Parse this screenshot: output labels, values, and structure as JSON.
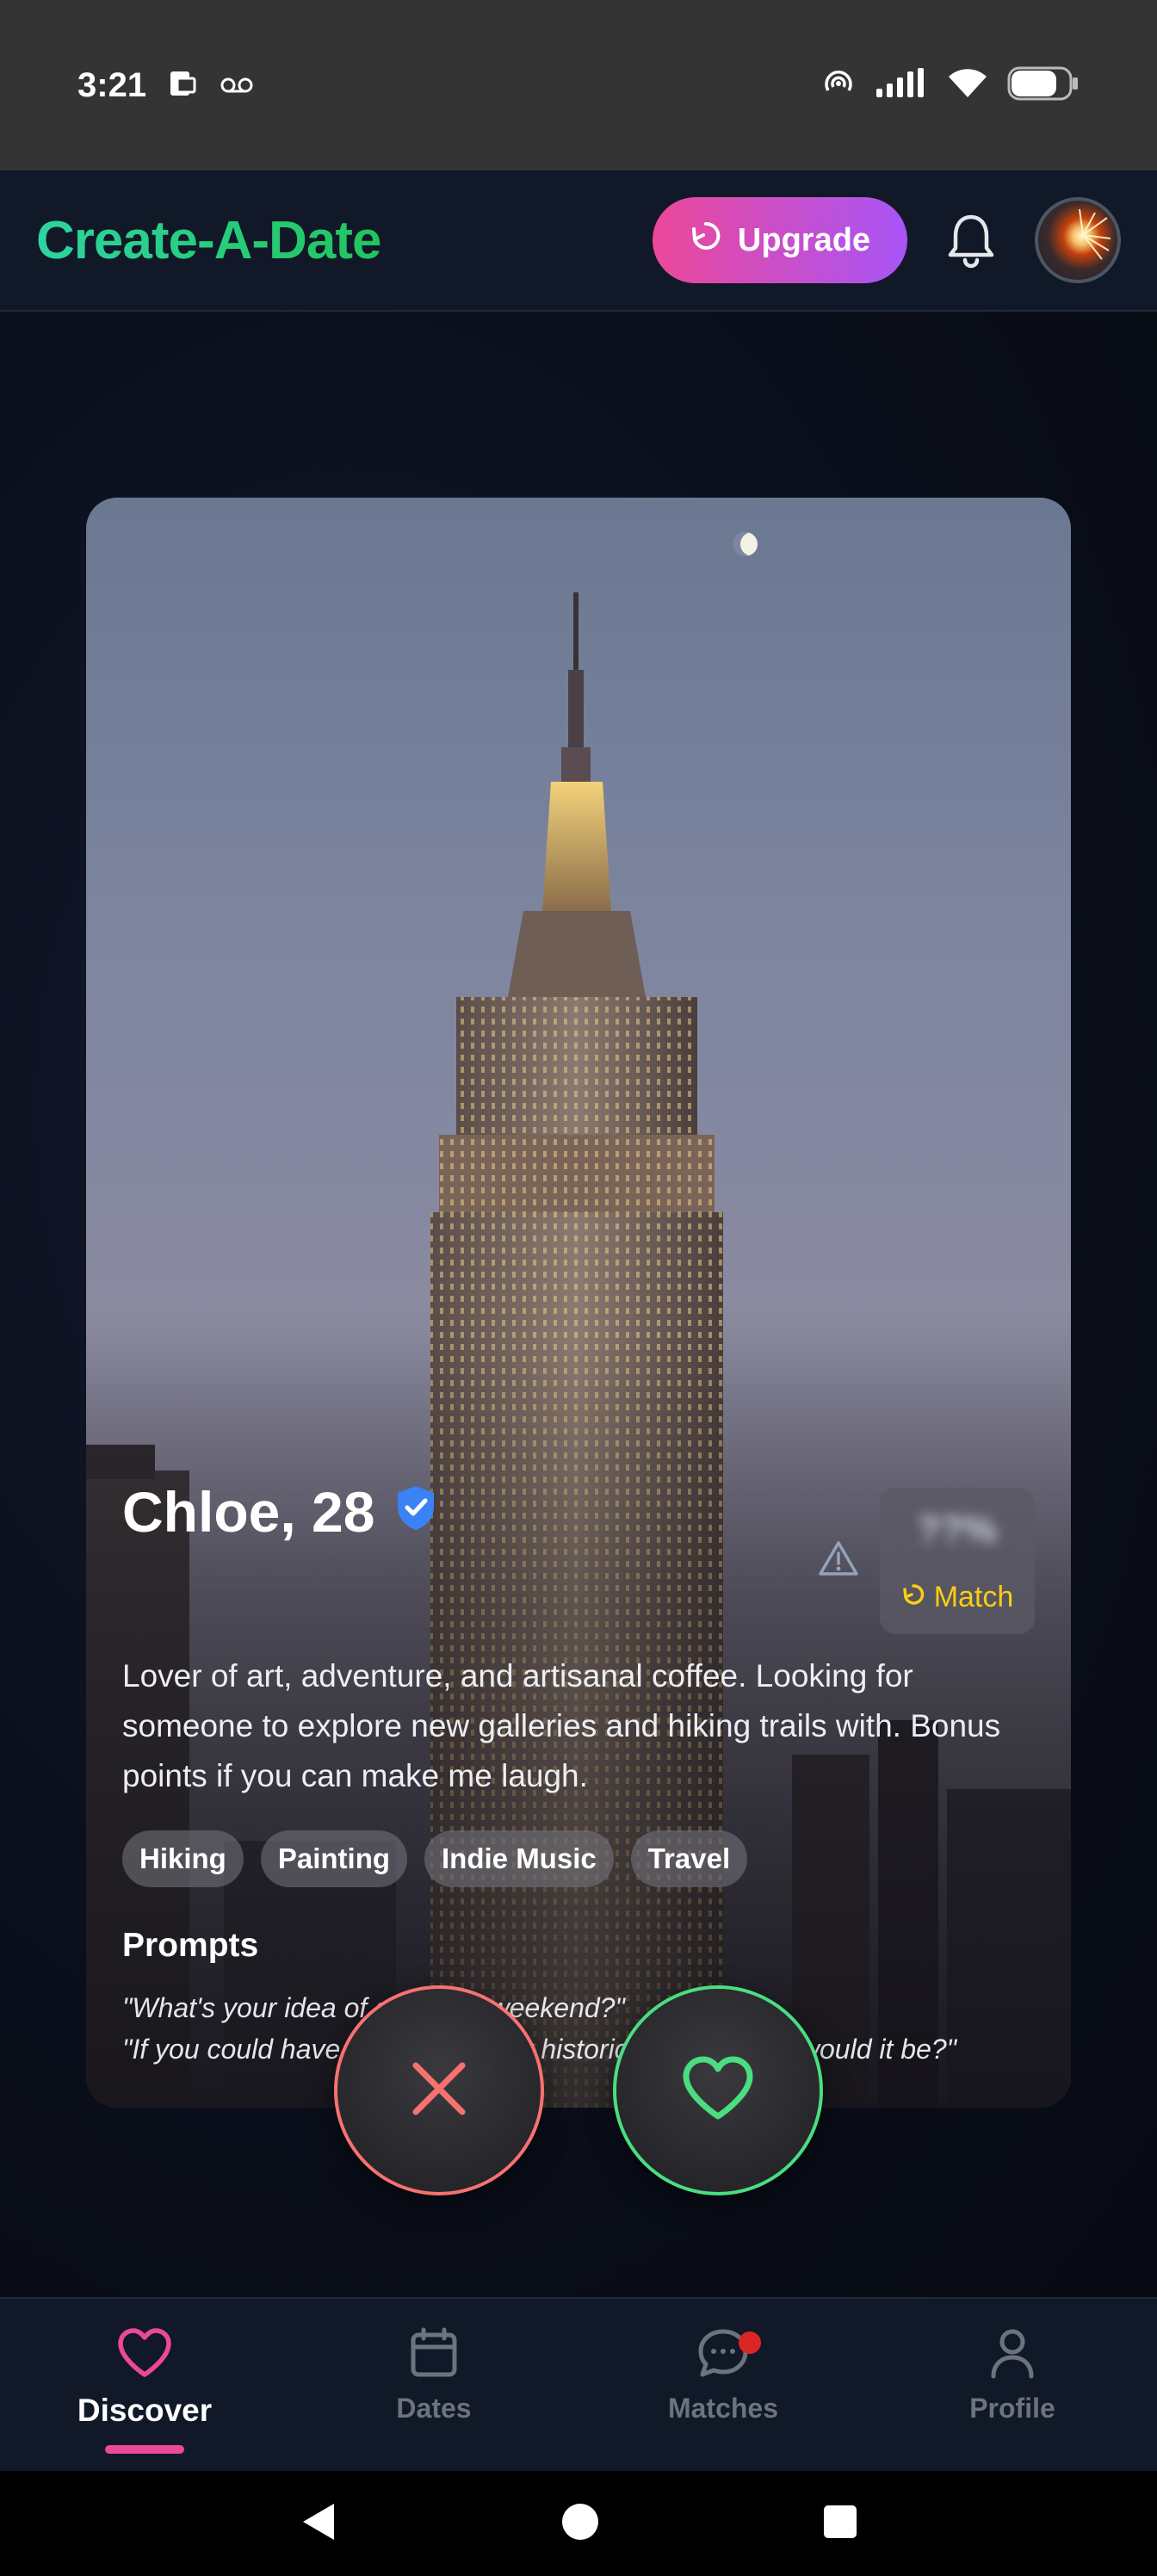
{
  "status_bar": {
    "time": "3:21"
  },
  "header": {
    "brand": "Create-A-Date",
    "upgrade_label": "Upgrade"
  },
  "profile": {
    "name_age": "Chloe, 28",
    "match_percent": "??%",
    "match_label": "Match",
    "bio": "Lover of art, adventure, and artisanal coffee. Looking for someone to explore new galleries and hiking trails with. Bonus points if you can make me laugh.",
    "tags": [
      "Hiking",
      "Painting",
      "Indie Music",
      "Travel"
    ],
    "prompts_title": "Prompts",
    "prompts": [
      "\"What's your idea of a perfect weekend?\"",
      "\"If you could have dinner with any historical figure, who would it be?\""
    ]
  },
  "bottom_nav": {
    "items": [
      {
        "label": "Discover",
        "icon": "heart-icon",
        "active": true
      },
      {
        "label": "Dates",
        "icon": "calendar-icon",
        "active": false
      },
      {
        "label": "Matches",
        "icon": "chat-icon",
        "active": false
      },
      {
        "label": "Profile",
        "icon": "user-icon",
        "active": false
      }
    ]
  },
  "colors": {
    "brand": "#2dd4a0",
    "upgrade_gradient_start": "#ec4899",
    "upgrade_gradient_end": "#a855f7",
    "pass": "#f87171",
    "like": "#4ade80",
    "match": "#facc15",
    "verified": "#3b82f6"
  }
}
